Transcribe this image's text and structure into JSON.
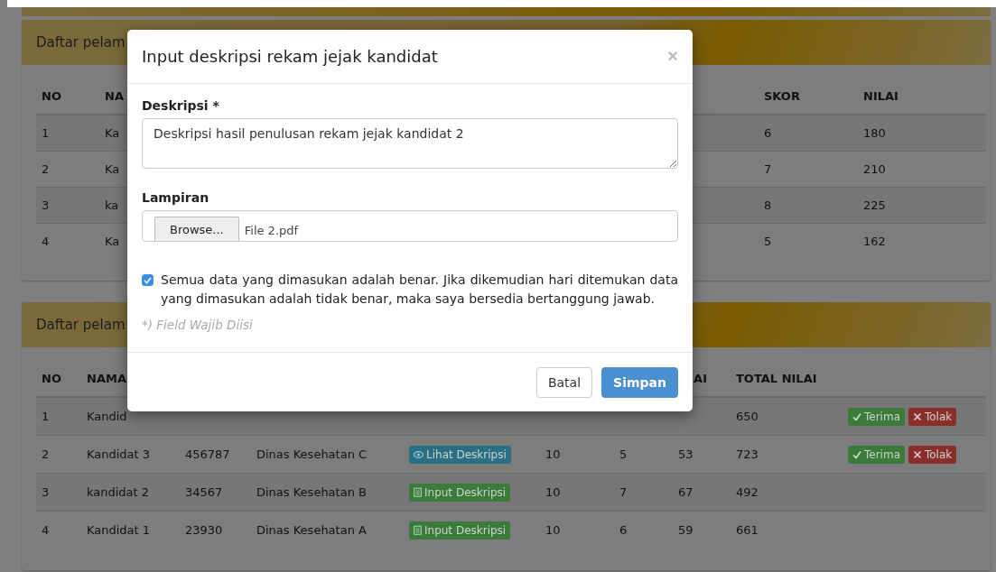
{
  "panels": [
    {
      "title": "Daftar pelam",
      "table": {
        "kind": "score",
        "header": {
          "no": "NO",
          "nama": "NA",
          "skor": "SKOR",
          "nilai": "NILAI"
        },
        "rows": [
          {
            "no": "1",
            "nama": "Ka",
            "skor": "6",
            "nilai": "180"
          },
          {
            "no": "2",
            "nama": "Ka",
            "skor": "7",
            "nilai": "210"
          },
          {
            "no": "3",
            "nama": "ka",
            "skor": "8",
            "nilai": "225"
          },
          {
            "no": "4",
            "nama": "Ka",
            "skor": "5",
            "nilai": "162"
          }
        ]
      }
    },
    {
      "title": "Daftar pelam",
      "table": {
        "kind": "total",
        "header": {
          "no": "NO",
          "nama": "NAMA",
          "column_8": "AI",
          "total_nilai": "TOTAL NILAI"
        },
        "rows": [
          {
            "no": "1",
            "nama": "Kandid",
            "total_nilai": "650",
            "actions": [
              {
                "kind": "accept",
                "label": "Terima"
              },
              {
                "kind": "reject",
                "label": "Tolak"
              }
            ]
          },
          {
            "no": "2",
            "nama": "Kandidat 3",
            "column_3": "456787",
            "column_4": "Dinas Kesehatan C",
            "column_5": {
              "kind": "view",
              "label": "Lihat Deskripsi"
            },
            "column_6": "10",
            "column_7": "5",
            "column_8": "53",
            "total_nilai": "723",
            "actions": [
              {
                "kind": "accept",
                "label": "Terima"
              },
              {
                "kind": "reject",
                "label": "Tolak"
              }
            ]
          },
          {
            "no": "3",
            "nama": "kandidat 2",
            "column_3": "34567",
            "column_4": "Dinas Kesehatan B",
            "column_5": {
              "kind": "input",
              "label": "Input Deskripsi"
            },
            "column_6": "10",
            "column_7": "7",
            "column_8": "67",
            "total_nilai": "492"
          },
          {
            "no": "4",
            "nama": "Kandidat 1",
            "column_3": "23930",
            "column_4": "Dinas Kesehatan A",
            "column_5": {
              "kind": "input",
              "label": "Input Deskripsi"
            },
            "column_6": "10",
            "column_7": "6",
            "column_8": "59",
            "total_nilai": "661"
          }
        ]
      }
    }
  ],
  "modal": {
    "title": "Input deskripsi rekam jejak kandidat",
    "close": "×",
    "description": {
      "label": "Deskripsi *",
      "value": "Deskripsi hasil penulusan rekam jejak kandidat 2"
    },
    "attachment": {
      "label": "Lampiran",
      "button": "Browse...",
      "file_name": "File 2.pdf"
    },
    "agreement": {
      "checked": true,
      "text": "Semua data yang dimasukan adalah benar. Jika dikemudian hari ditemukan data yang dimasukan adalah tidak benar, maka saya bersedia bertanggung jawab."
    },
    "note": "*) Field Wajib Diisi",
    "buttons": [
      {
        "kind": "cancel",
        "label": "Batal"
      },
      {
        "kind": "primary",
        "label": "Simpan"
      }
    ]
  }
}
